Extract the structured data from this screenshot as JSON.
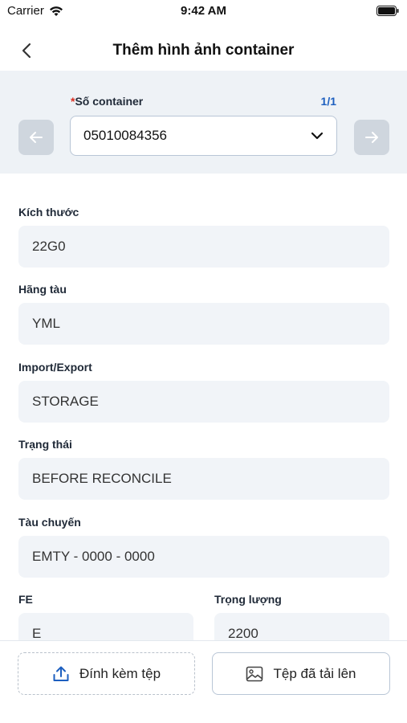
{
  "status_bar": {
    "carrier": "Carrier",
    "time": "9:42 AM"
  },
  "nav": {
    "title": "Thêm hình ảnh container"
  },
  "container_selector": {
    "required_mark": "*",
    "label": "Số container",
    "counter": "1/1",
    "selected_value": "05010084356"
  },
  "fields": {
    "size": {
      "label": "Kích thước",
      "value": "22G0"
    },
    "shipping_line": {
      "label": "Hãng tàu",
      "value": "YML"
    },
    "import_export": {
      "label": "Import/Export",
      "value": "STORAGE"
    },
    "status": {
      "label": "Trạng thái",
      "value": "BEFORE RECONCILE"
    },
    "transfer_vessel": {
      "label": "Tàu chuyến",
      "value": "EMTY - 0000 - 0000"
    },
    "fe": {
      "label": "FE",
      "value": "E"
    },
    "weight": {
      "label": "Trọng lượng",
      "value": "2200"
    }
  },
  "bottom_actions": {
    "attach_label": "Đính kèm tệp",
    "uploaded_label": "Tệp đã tải lên"
  },
  "colors": {
    "accent": "#1d5fbf",
    "required": "#d92d20",
    "panel_bg": "#eef2f6",
    "field_bg": "#f1f4f8"
  }
}
